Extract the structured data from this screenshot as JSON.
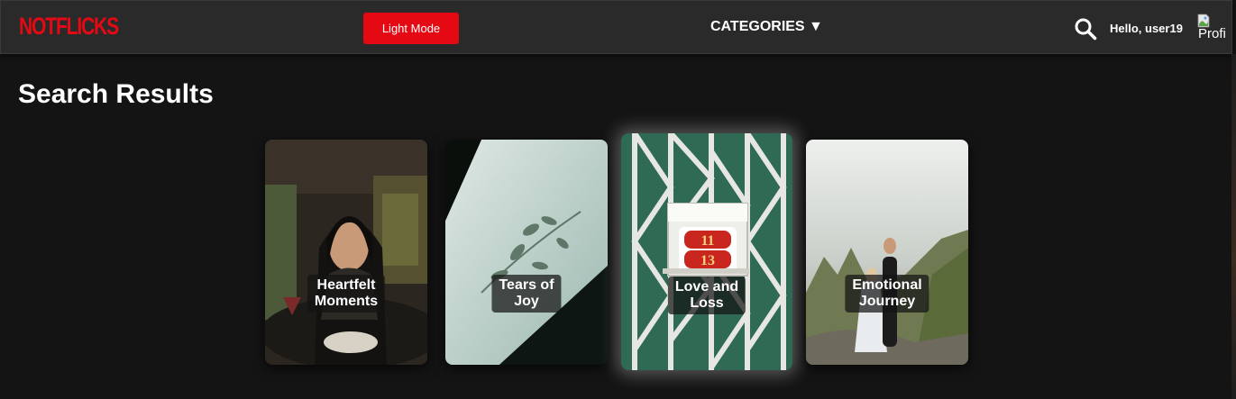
{
  "app": {
    "logo": "NOTFLICKS",
    "brand_color": "#e50914"
  },
  "header": {
    "mode_button_label": "Light Mode",
    "categories_label": "CATEGORIES ▼",
    "greeting": "Hello, user19",
    "avatar_alt": "Profi"
  },
  "main": {
    "heading": "Search Results",
    "cards": [
      {
        "title": "Heartfelt\nMoments"
      },
      {
        "title": "Tears of\nJoy"
      },
      {
        "title": "Love and\nLoss",
        "door_numbers": [
          "11",
          "13"
        ]
      },
      {
        "title": "Emotional\nJourney"
      }
    ]
  },
  "icons": [
    "search-icon",
    "broken-image-icon"
  ]
}
